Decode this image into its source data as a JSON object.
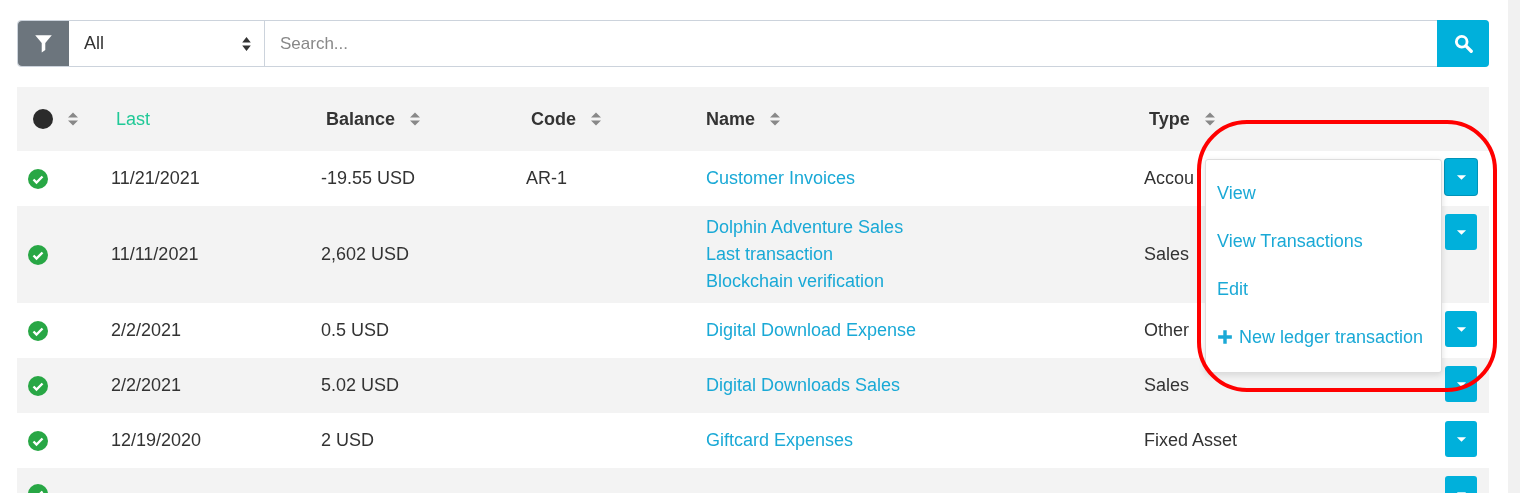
{
  "filter": {
    "select_value": "All",
    "search_placeholder": "Search..."
  },
  "columns": [
    {
      "kind": "status",
      "sorted": false
    },
    {
      "kind": "text",
      "label": "Last",
      "sorted": true
    },
    {
      "kind": "text",
      "label": "Balance",
      "sorted": false
    },
    {
      "kind": "text",
      "label": "Code",
      "sorted": false
    },
    {
      "kind": "text",
      "label": "Name",
      "sorted": false
    },
    {
      "kind": "text",
      "label": "Type",
      "sorted": false
    }
  ],
  "rows": [
    {
      "status_ok": true,
      "last": "11/21/2021",
      "balance": "-19.55 USD",
      "code": "AR-1",
      "name_links": [
        "Customer Invoices"
      ],
      "type": "Accou",
      "menu_open": true
    },
    {
      "status_ok": true,
      "last": "11/11/2021",
      "balance": "2,602 USD",
      "name_links": [
        "Dolphin Adventure Sales",
        "Last transaction",
        "Blockchain verification"
      ],
      "type": "Sales",
      "menu_open": false
    },
    {
      "status_ok": true,
      "last": "2/2/2021",
      "balance": "0.5 USD",
      "name_links": [
        "Digital Download Expense"
      ],
      "type": "Other",
      "menu_open": false
    },
    {
      "status_ok": true,
      "last": "2/2/2021",
      "balance": "5.02 USD",
      "name_links": [
        "Digital Downloads Sales"
      ],
      "type": "Sales",
      "menu_open": false
    },
    {
      "status_ok": true,
      "last": "12/19/2020",
      "balance": "2 USD",
      "name_links": [
        "Giftcard Expenses"
      ],
      "type": "Fixed Asset",
      "menu_open": false
    },
    {
      "status_ok": true,
      "menu_open": false
    }
  ],
  "row_menu": [
    {
      "kind": "link",
      "label": "View"
    },
    {
      "kind": "link",
      "label": "View Transactions"
    },
    {
      "kind": "link",
      "label": "Edit"
    },
    {
      "kind": "add",
      "label": "New ledger transaction"
    }
  ],
  "annotation": {
    "kind": "ring",
    "color": "#ff0000"
  }
}
